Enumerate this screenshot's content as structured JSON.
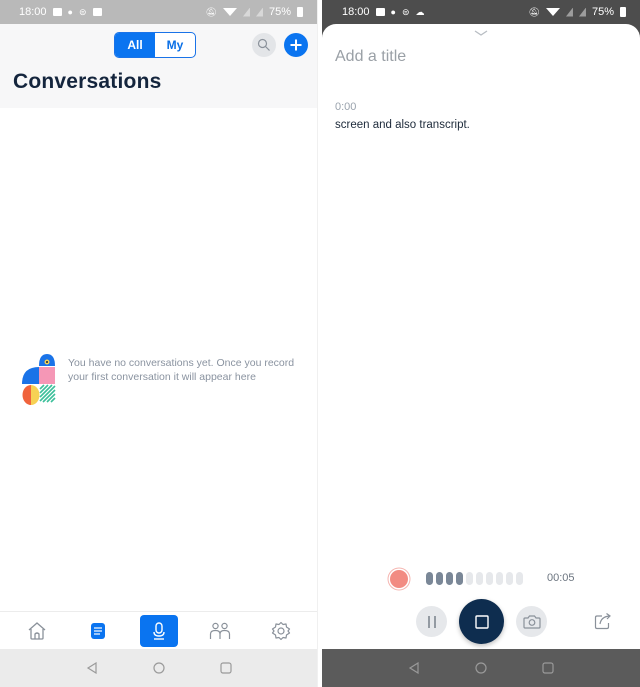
{
  "left_screen": {
    "status_bar": {
      "time": "18:00",
      "left_icons": [
        "gmail-icon",
        "evernote-icon",
        "sync-icon",
        "image-icon"
      ],
      "right_icons": [
        "mute-icon",
        "wifi-icon",
        "no-sim-icon",
        "no-sim-icon"
      ],
      "battery": "75%"
    },
    "header": {
      "filter_options": [
        {
          "label": "All",
          "active": true
        },
        {
          "label": "My",
          "active": false
        }
      ],
      "search_icon": "search-icon",
      "add_icon": "plus-icon",
      "title": "Conversations"
    },
    "empty_state": {
      "message": "You have no conversations yet. Once you record your first conversation it will appear here"
    },
    "bottom_nav": [
      {
        "name": "home",
        "icon": "home-icon",
        "active": false
      },
      {
        "name": "conversations",
        "icon": "notes-icon",
        "active": true
      },
      {
        "name": "record",
        "icon": "microphone-icon",
        "active": false,
        "highlighted": true
      },
      {
        "name": "groups",
        "icon": "people-icon",
        "active": false
      },
      {
        "name": "settings",
        "icon": "gear-icon",
        "active": false
      }
    ],
    "system_nav": [
      "back-icon",
      "home-circle-icon",
      "recents-icon"
    ]
  },
  "right_screen": {
    "status_bar": {
      "time": "18:00",
      "left_icons": [
        "gmail-icon",
        "evernote-icon",
        "sync-icon",
        "cloud-upload-icon"
      ],
      "right_icons": [
        "mute-icon",
        "wifi-icon",
        "no-sim-icon",
        "no-sim-icon"
      ],
      "battery": "75%"
    },
    "title_placeholder": "Add a title",
    "transcript": [
      {
        "timestamp": "0:00",
        "text": "screen and also transcript."
      }
    ],
    "recorder": {
      "status": "recording",
      "level_bars_total": 10,
      "level_bars_active": 4,
      "elapsed": "00:05"
    },
    "controls": {
      "pause_icon": "pause-icon",
      "stop_icon": "stop-icon",
      "camera_icon": "camera-icon",
      "share_icon": "share-icon"
    },
    "colors": {
      "accent": "#0a74f0",
      "stop_button": "#0e2d4f",
      "record_dot": "#f28b82"
    }
  }
}
